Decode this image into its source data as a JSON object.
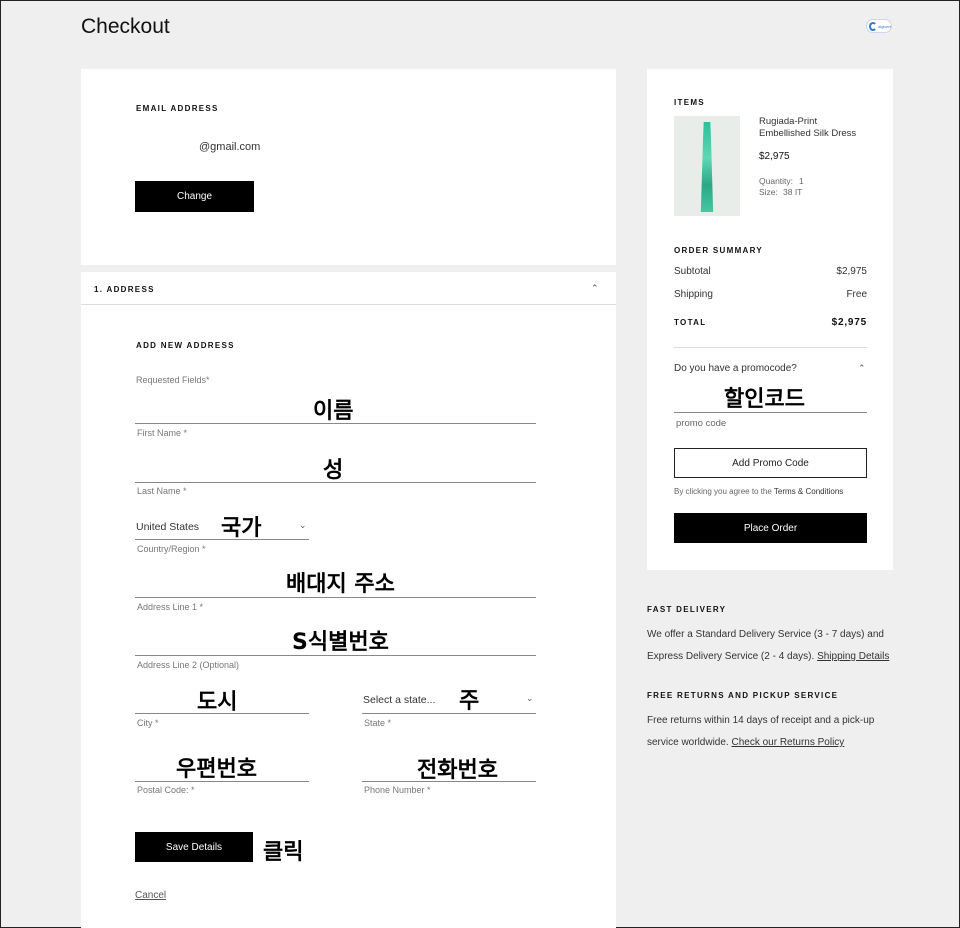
{
  "page": {
    "title": "Checkout",
    "logo_alt": "digicert"
  },
  "email": {
    "heading": "EMAIL ADDRESS",
    "value": "@gmail.com",
    "change_label": "Change"
  },
  "address": {
    "step_title": "1. ADDRESS",
    "add_new_heading": "ADD NEW ADDRESS",
    "required_note": "Requested Fields*",
    "fields": {
      "first_name": {
        "label": "First Name *",
        "annotation": "이름"
      },
      "last_name": {
        "label": "Last Name *",
        "annotation": "성"
      },
      "country": {
        "label": "Country/Region *",
        "value": "United States",
        "annotation": "국가"
      },
      "address1": {
        "label": "Address Line 1 *",
        "annotation": "배대지 주소"
      },
      "address2": {
        "label": "Address Line 2 (Optional)",
        "annotation": "S식별번호"
      },
      "city": {
        "label": "City *",
        "annotation": "도시"
      },
      "state": {
        "label": "State *",
        "placeholder": "Select a state...",
        "annotation": "주"
      },
      "postal": {
        "label": "Postal Code: *",
        "annotation": "우편번호"
      },
      "phone": {
        "label": "Phone Number *",
        "annotation": "전화번호"
      }
    },
    "save_label": "Save Details",
    "save_annotation": "클릭",
    "cancel_label": "Cancel"
  },
  "cart": {
    "items_heading": "ITEMS",
    "item": {
      "name": "Rugiada-Print Embellished Silk Dress",
      "price": "$2,975",
      "quantity_label": "Quantity:",
      "quantity": "1",
      "size_label": "Size:",
      "size": "38 IT"
    },
    "summary_heading": "ORDER SUMMARY",
    "subtotal_label": "Subtotal",
    "subtotal": "$2,975",
    "shipping_label": "Shipping",
    "shipping": "Free",
    "total_label": "TOTAL",
    "total": "$2,975",
    "promo_question": "Do you have a promocode?",
    "promo_annotation": "할인코드",
    "promo_placeholder": "promo code",
    "add_promo_label": "Add Promo Code",
    "terms_prefix": "By clicking you agree to the",
    "terms_link": "Terms & Conditions",
    "place_order_label": "Place Order"
  },
  "info": {
    "fast_delivery_heading": "FAST DELIVERY",
    "fast_delivery_line1": "We offer a Standard Delivery Service (3 - 7 days) and",
    "fast_delivery_line2": "Express Delivery Service (2 - 4 days).",
    "shipping_details_link": "Shipping Details",
    "returns_heading": "FREE RETURNS AND PICKUP SERVICE",
    "returns_line1": "Free returns within 14 days of receipt and a pick-up",
    "returns_line2": "service worldwide.",
    "returns_link": "Check our Returns Policy"
  }
}
